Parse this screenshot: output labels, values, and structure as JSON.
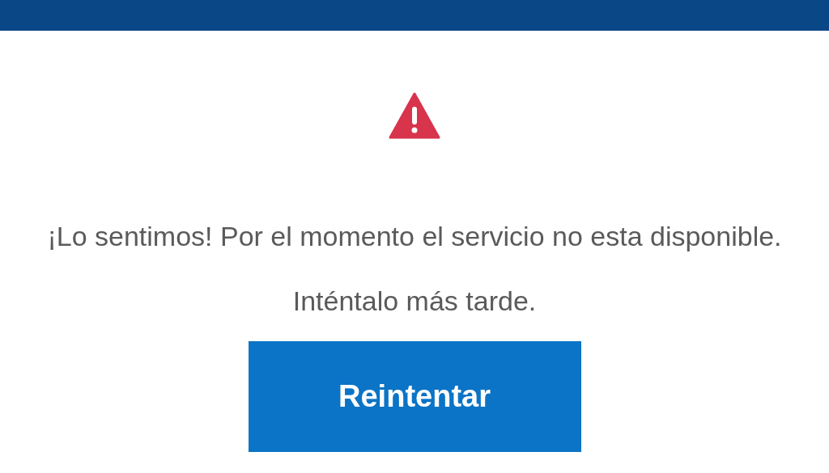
{
  "header": {
    "kind": "bar"
  },
  "message": "¡Lo sentimos! Por el momento el servicio no esta disponible. Inténtalo más tarde.",
  "retry_button": "Reintentar"
}
